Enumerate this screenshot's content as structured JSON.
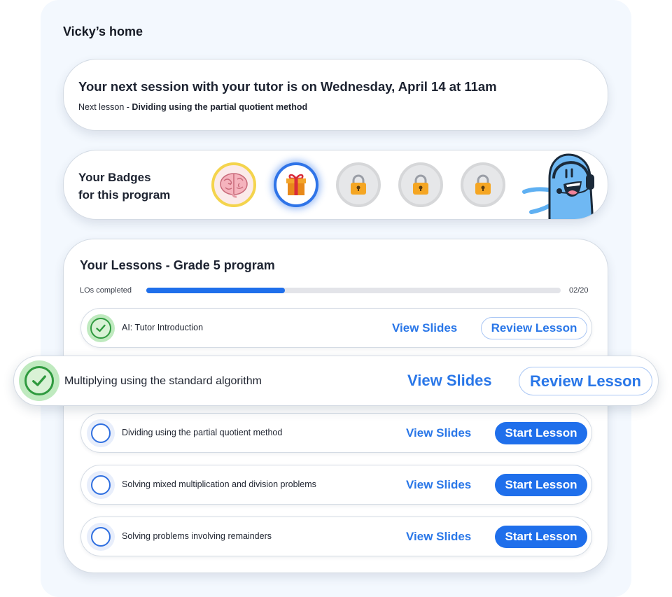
{
  "home": {
    "title": "Vicky’s home"
  },
  "session": {
    "title": "Your next session with your tutor is on Wednesday, April 14 at 11am",
    "next_prefix": "Next lesson - ",
    "next_lesson": "Dividing using the partial quotient method"
  },
  "badges": {
    "title_line1": "Your Badges",
    "title_line2": "for this program",
    "items": [
      {
        "icon": "brain-icon",
        "state": "earned"
      },
      {
        "icon": "gift-icon",
        "state": "current"
      },
      {
        "icon": "lock-icon",
        "state": "locked"
      },
      {
        "icon": "lock-icon",
        "state": "locked"
      },
      {
        "icon": "lock-icon",
        "state": "locked"
      }
    ]
  },
  "lessons": {
    "title": "Your Lessons - Grade 5 program",
    "progress": {
      "label": "LOs completed",
      "completed": 2,
      "total": 20,
      "text": "02/20"
    },
    "items": [
      {
        "title": "AI: Tutor Introduction",
        "status": "completed",
        "view": "View Slides",
        "action": "Review Lesson"
      },
      {
        "title": "Multiplying using the standard algorithm",
        "status": "completed",
        "view": "View Slides",
        "action": "Review Lesson"
      },
      {
        "title": "Dividing using the partial quotient method",
        "status": "not-started",
        "view": "View Slides",
        "action": "Start Lesson"
      },
      {
        "title": "Solving mixed multiplication and division problems",
        "status": "not-started",
        "view": "View Slides",
        "action": "Start Lesson"
      },
      {
        "title": "Solving problems involving remainders",
        "status": "not-started",
        "view": "View Slides",
        "action": "Start Lesson"
      }
    ]
  },
  "colors": {
    "accent": "#1f6feb",
    "done": "#2f9a3f",
    "badge_gold": "#f4d44d",
    "panel_bg": "#f3f8fe"
  }
}
